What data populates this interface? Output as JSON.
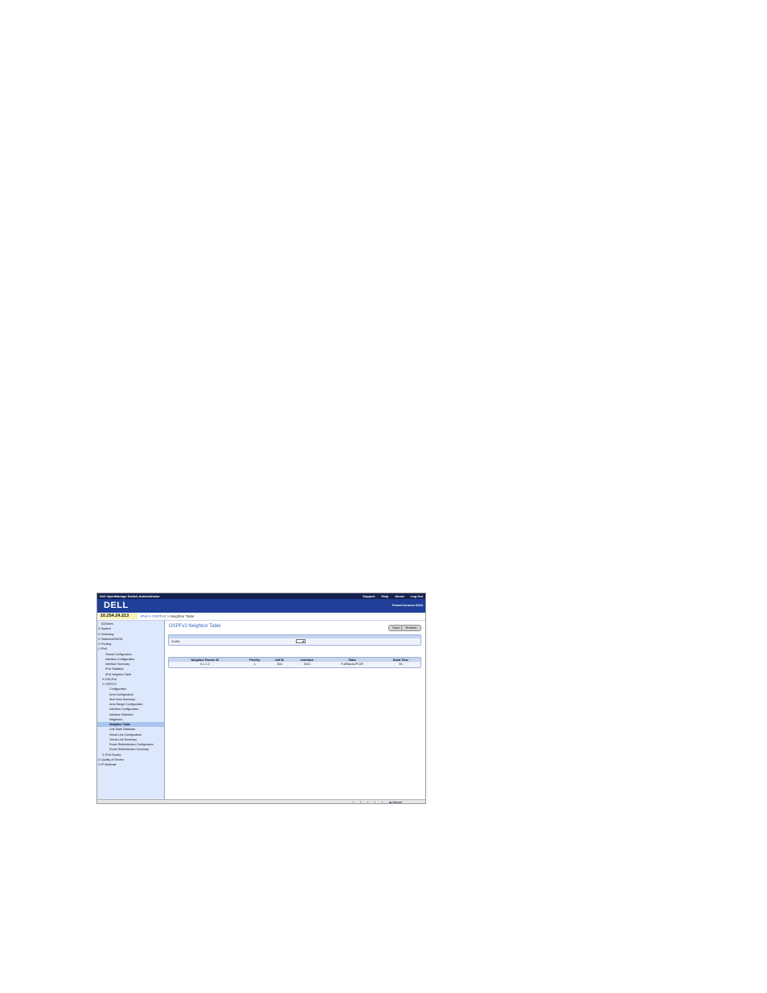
{
  "window": {
    "title": "Dell OpenManage Switch Administrator",
    "links": [
      "Support",
      "Help",
      "About",
      "Log Out"
    ]
  },
  "banner": {
    "logo": "DELL",
    "product": "PowerConnect 6224"
  },
  "header": {
    "ip": "10.254.24.213",
    "breadcrumb": {
      "items": [
        "IPv6",
        "OSPFv3"
      ],
      "separator": ">",
      "current": "Neighbor Table"
    }
  },
  "sidebar": {
    "items": [
      {
        "label": "6224rees",
        "toggle": "",
        "indent": 0
      },
      {
        "label": "System",
        "toggle": "⊞",
        "indent": 0
      },
      {
        "label": "Switching",
        "toggle": "⊞",
        "indent": 0
      },
      {
        "label": "Statistics/RMON",
        "toggle": "⊞",
        "indent": 0
      },
      {
        "label": "Routing",
        "toggle": "⊞",
        "indent": 0
      },
      {
        "label": "IPv6",
        "toggle": "⊟",
        "indent": 0
      },
      {
        "label": "Global Configuration",
        "toggle": "",
        "indent": 1
      },
      {
        "label": "Interface Configuration",
        "toggle": "",
        "indent": 1
      },
      {
        "label": "Interface Summary",
        "toggle": "",
        "indent": 1
      },
      {
        "label": "IPv6 Statistics",
        "toggle": "",
        "indent": 1
      },
      {
        "label": "IPv6 Neighbor Table",
        "toggle": "",
        "indent": 1
      },
      {
        "label": "DHCPv6",
        "toggle": "⊞",
        "indent": 1
      },
      {
        "label": "OSPFv3",
        "toggle": "⊟",
        "indent": 1
      },
      {
        "label": "Configuration",
        "toggle": "",
        "indent": 2
      },
      {
        "label": "Area Configuration",
        "toggle": "",
        "indent": 2
      },
      {
        "label": "Stub Area Summary",
        "toggle": "",
        "indent": 2
      },
      {
        "label": "Area Range Configuration",
        "toggle": "",
        "indent": 2
      },
      {
        "label": "Interface Configuration",
        "toggle": "",
        "indent": 2
      },
      {
        "label": "Interface Statistics",
        "toggle": "",
        "indent": 2
      },
      {
        "label": "Neighbors",
        "toggle": "",
        "indent": 2
      },
      {
        "label": "Neighbor Table",
        "toggle": "",
        "indent": 2,
        "selected": true
      },
      {
        "label": "Link State Database",
        "toggle": "",
        "indent": 2
      },
      {
        "label": "Virtual Link Configuration",
        "toggle": "",
        "indent": 2
      },
      {
        "label": "Virtual Link Summary",
        "toggle": "",
        "indent": 2
      },
      {
        "label": "Route Redistribution Configuration",
        "toggle": "",
        "indent": 2
      },
      {
        "label": "Route Redistribution Summary",
        "toggle": "",
        "indent": 2
      },
      {
        "label": "IPv6 Routes",
        "toggle": "⊞",
        "indent": 1
      },
      {
        "label": "Quality of Service",
        "toggle": "⊞",
        "indent": 0
      },
      {
        "label": "IP Multicast",
        "toggle": "⊞",
        "indent": 0
      }
    ]
  },
  "main": {
    "title": "OSPFv3 Neighbor Table",
    "buttons": {
      "save": "Save",
      "refresh": "Refresh"
    },
    "vlan": {
      "label": "VLAN",
      "selected": ""
    },
    "table": {
      "columns": [
        "Neighbor Router ID",
        "Priority",
        "Intf ID",
        "Interface",
        "State",
        "Dead Time"
      ],
      "rows": [
        [
          "5.1.1.2",
          "1",
          "634",
          "0/4/1",
          "Full/BackUP-DR",
          "33"
        ]
      ]
    }
  },
  "statusbar": {
    "left": "",
    "zone": "Internet"
  }
}
